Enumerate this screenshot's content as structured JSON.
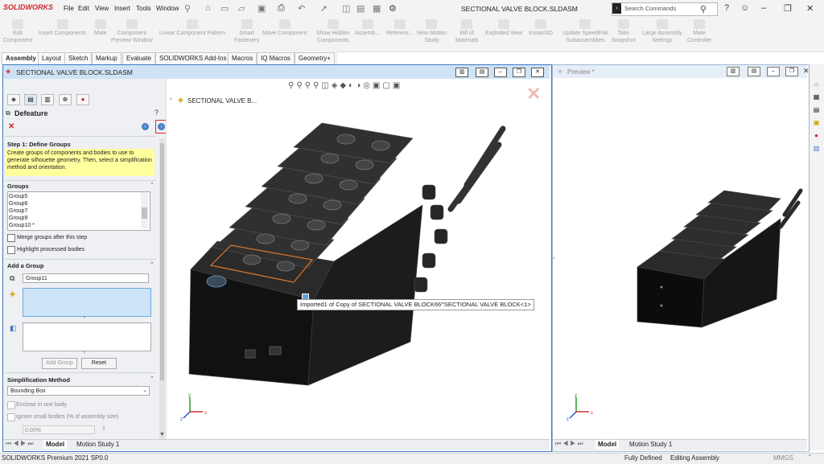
{
  "app": {
    "logo": "SOLIDWORKS",
    "doc_title": "SECTIONAL VALVE BLOCK.SLDASM"
  },
  "menu": [
    "File",
    "Edit",
    "View",
    "Insert",
    "Tools",
    "Window"
  ],
  "search": {
    "placeholder": "Search Commands"
  },
  "commands": [
    {
      "label": "Edit\nComponent"
    },
    {
      "label": "Insert Components"
    },
    {
      "label": "Mate"
    },
    {
      "label": "Component\nPreview Window"
    },
    {
      "label": "Linear Component Pattern"
    },
    {
      "label": "Smart\nFasteners"
    },
    {
      "label": "Move Component"
    },
    {
      "label": "Show Hidden\nComponents"
    },
    {
      "label": "Assemb..."
    },
    {
      "label": "Referenc..."
    },
    {
      "label": "New Motion\nStudy"
    },
    {
      "label": "Bill of\nMaterials"
    },
    {
      "label": "Exploded View"
    },
    {
      "label": "Instant3D"
    },
    {
      "label": "Update SpeedPak\nSubassemblies"
    },
    {
      "label": "Take\nSnapshot"
    },
    {
      "label": "Large Assembly\nSettings"
    },
    {
      "label": "Mate\nController"
    }
  ],
  "tabs": [
    "Assembly",
    "Layout",
    "Sketch",
    "Markup",
    "Evaluate",
    "SOLIDWORKS Add-Ins",
    "Macros",
    "IQ Macros",
    "Geometry+"
  ],
  "doc_window": {
    "title": "SECTIONAL VALVE BLOCK.SLDASM",
    "tree_label": "SECTIONAL VALVE B..."
  },
  "pm": {
    "title": "Defeature",
    "step_header": "Step 1: Define Groups",
    "message": "Create groups of components and bodies to use to generate silhouette geometry. Then, select a simplification method and orientation.",
    "groups_header": "Groups",
    "groups": [
      "Group5",
      "Group6",
      "Group7",
      "Group9",
      "Group10 *"
    ],
    "merge_label": "Merge groups after this step",
    "highlight_label": "Highlight processed bodies",
    "add_group_header": "Add a Group",
    "group_name": "Group11",
    "add_group_btn": "Add Group",
    "reset_btn": "Reset",
    "method_header": "Simplification Method",
    "method_value": "Bounding Box",
    "enclose_label": "Enclose in one body",
    "ignore_label": "Ignore small bodies (% of assembly size)",
    "percent": "0.00%"
  },
  "tooltip": "Imported1 of Copy of SECTIONAL VALVE BLOCK66^SECTIONAL VALVE BLOCK<1>",
  "bottom_tabs": {
    "model": "Model",
    "motion": "Motion Study 1"
  },
  "preview": {
    "title": "Preview *"
  },
  "status": {
    "left": "SOLIDWORKS Premium 2021 SP0.0",
    "defined": "Fully Defined",
    "mode": "Editing Assembly",
    "units": "MMGS"
  },
  "colors": {
    "accent": "#3c78c8",
    "highlight": "#e8242c",
    "message_bg": "#ffff9e"
  }
}
